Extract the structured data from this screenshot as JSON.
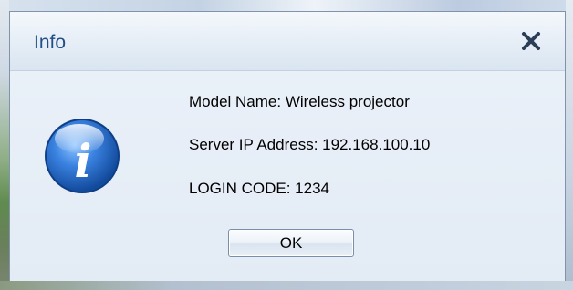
{
  "window": {
    "title": "Info",
    "close_icon": "close-icon"
  },
  "message": {
    "icon": "info-icon",
    "model_name": "Model Name: Wireless projector",
    "server_ip": "Server IP Address: 192.168.100.10",
    "login_code": "LOGIN CODE: 1234"
  },
  "buttons": {
    "ok_label": "OK"
  },
  "colors": {
    "title_text": "#1f4f86",
    "window_bg": "#e3ecf6",
    "icon_blue": "#2f6fd0"
  }
}
